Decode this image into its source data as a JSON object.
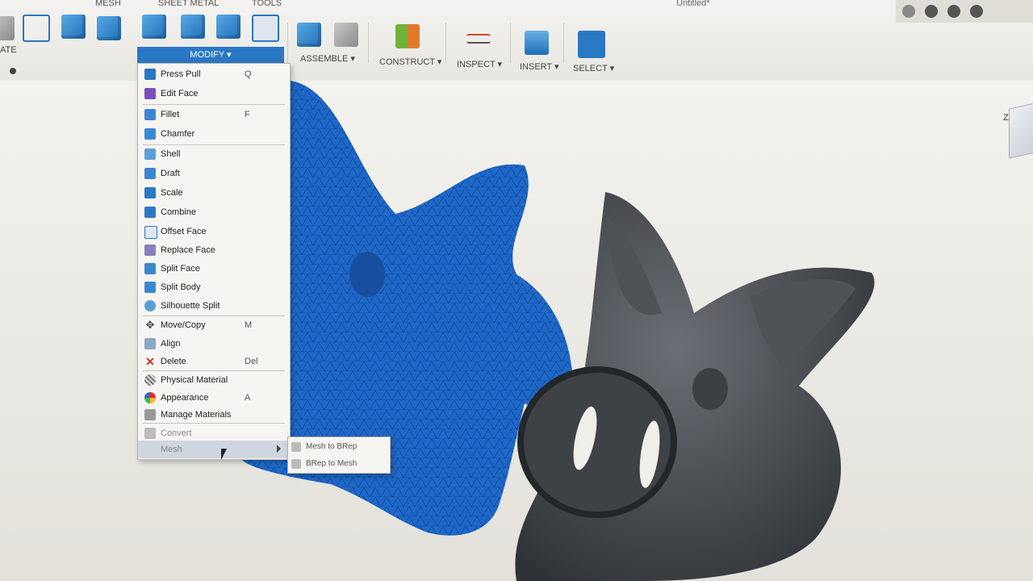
{
  "ribbon": {
    "tabs": [
      {
        "label": "MESH"
      },
      {
        "label": "SHEET METAL"
      },
      {
        "label": "TOOLS"
      }
    ],
    "groups": {
      "create_partial": "ATE",
      "modify": "MODIFY",
      "assemble": "ASSEMBLE",
      "construct": "CONSTRUCT",
      "inspect": "INSPECT",
      "insert": "INSERT",
      "select": "SELECT"
    },
    "document_title": "Untitled*"
  },
  "modify_menu": {
    "items": [
      {
        "label": "Press Pull",
        "key": "Q"
      },
      {
        "label": "Edit Face",
        "key": ""
      },
      {
        "label": "Fillet",
        "key": "F"
      },
      {
        "label": "Chamfer",
        "key": ""
      },
      {
        "label": "Shell",
        "key": ""
      },
      {
        "label": "Draft",
        "key": ""
      },
      {
        "label": "Scale",
        "key": ""
      },
      {
        "label": "Combine",
        "key": ""
      },
      {
        "label": "Offset Face",
        "key": ""
      },
      {
        "label": "Replace Face",
        "key": ""
      },
      {
        "label": "Split Face",
        "key": ""
      },
      {
        "label": "Split Body",
        "key": ""
      },
      {
        "label": "Silhouette Split",
        "key": ""
      },
      {
        "label": "Move/Copy",
        "key": "M"
      },
      {
        "label": "Align",
        "key": ""
      },
      {
        "label": "Delete",
        "key": "Del"
      },
      {
        "label": "Physical Material",
        "key": ""
      },
      {
        "label": "Appearance",
        "key": "A"
      },
      {
        "label": "Manage Materials",
        "key": ""
      },
      {
        "label": "Convert",
        "key": ""
      },
      {
        "label": "Mesh",
        "key": ""
      }
    ]
  },
  "mesh_submenu": {
    "items": [
      {
        "label": "Mesh to BRep"
      },
      {
        "label": "BRep to Mesh"
      }
    ]
  },
  "viewcube": {
    "axis_label": "Z"
  },
  "colors": {
    "accent": "#2a78c4",
    "mesh_model": "#1f68c9",
    "solid_model": "#4a4d52"
  }
}
